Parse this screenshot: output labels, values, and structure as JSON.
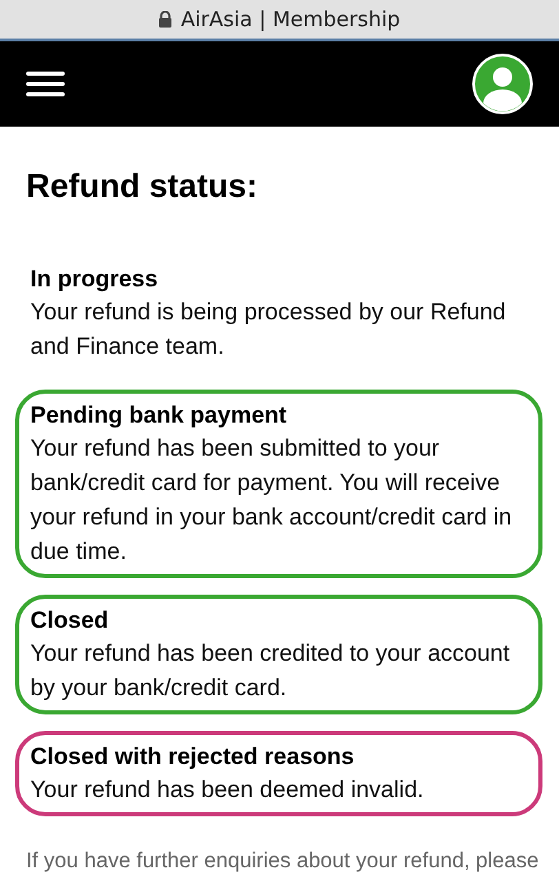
{
  "browser_bar": {
    "title": "AirAsia | Membership"
  },
  "page_title": "Refund status:",
  "statuses": [
    {
      "title": "In progress",
      "text": "Your refund is being processed by our Refund and Finance team."
    },
    {
      "title": "Pending bank payment",
      "text": "Your refund has been submitted to your bank/credit card for payment. You will receive your refund in your bank account/credit card in due time.",
      "color": "#3aa832"
    },
    {
      "title": "Closed",
      "text": "Your refund has been credited to your account by your bank/credit card.",
      "color": "#3aa832"
    },
    {
      "title": "Closed with rejected reasons",
      "text": "Your refund has been deemed invalid.",
      "color": "#cc3a7a"
    }
  ],
  "footer_note": "If you have further enquiries about your refund, please"
}
